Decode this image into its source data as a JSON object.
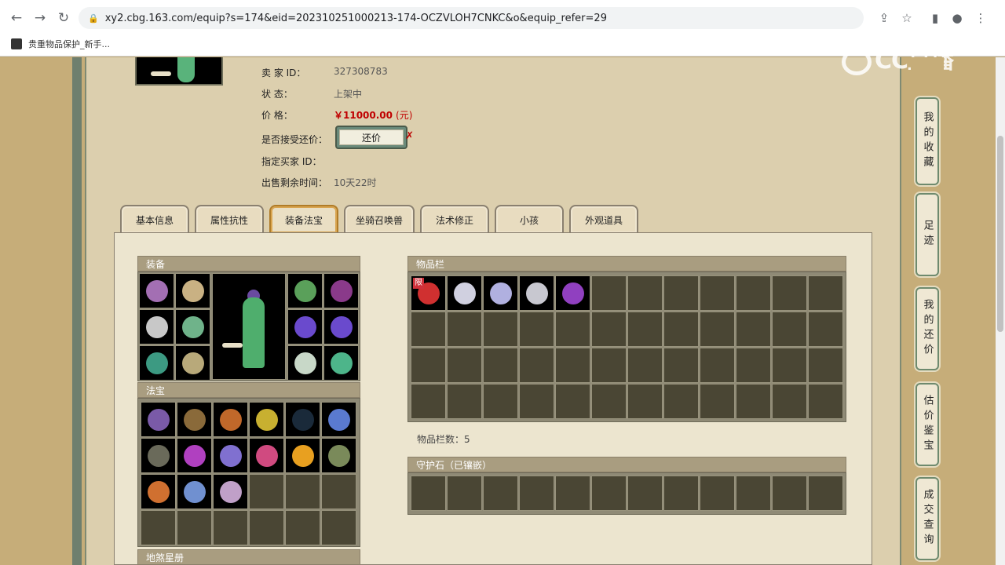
{
  "browser": {
    "url": "xy2.cbg.163.com/equip?s=174&eid=202310251000213-174-OCZVLOH7CNKC&o&equip_refer=29",
    "bookmark": "贵重物品保护_新手...",
    "watermark": "CC直播"
  },
  "info": {
    "seller_label": "卖    家    ID：",
    "seller_value": "327308783",
    "status_label": "状          态：",
    "status_value": "上架中",
    "price_label": "价          格：",
    "price_value": "￥11000.00",
    "price_unit": "(元)",
    "bargain_label": "是否接受还价：",
    "bargain_button": "还价",
    "buyer_label": "指定买家 ID：",
    "time_label": "出售剩余时间：",
    "time_value": "10天22时"
  },
  "tabs": [
    "基本信息",
    "属性抗性",
    "装备法宝",
    "坐骑召唤兽",
    "法术修正",
    "小孩",
    "外观道具"
  ],
  "sections": {
    "equip": "装备",
    "treasure": "法宝",
    "inventory": "物品栏",
    "inventory_count": "物品栏数：5",
    "guard_stone": "守护石（已镶嵌）",
    "star_book": "地煞星册"
  },
  "inventory_badge": "限",
  "right_nav": [
    "我的收藏",
    "足迹",
    "我的还价",
    "估价鉴宝",
    "成交查询"
  ],
  "colors": {
    "accent": "#c00000",
    "panel": "#dccfae",
    "cell": "#4a4634"
  }
}
